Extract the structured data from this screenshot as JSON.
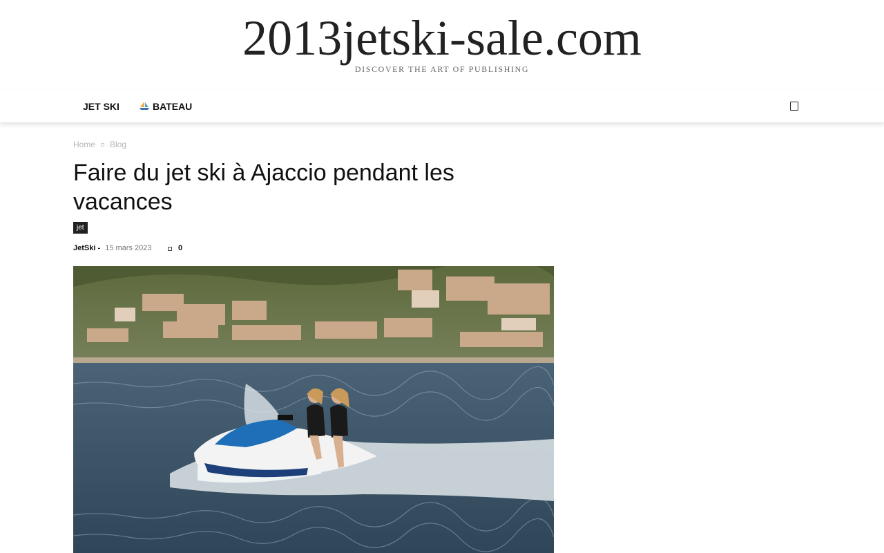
{
  "site": {
    "logo_text": "2013jetski-sale.com",
    "tagline": "DISCOVER THE ART OF PUBLISHING"
  },
  "menu": {
    "items": [
      {
        "label": "JET SKI"
      },
      {
        "label": "BATEAU",
        "icon": "sailboat-icon"
      }
    ],
    "search_icon": "search-icon"
  },
  "breadcrumb": {
    "items": [
      "Home",
      "Blog"
    ]
  },
  "post": {
    "title": "Faire du jet ski à Ajaccio pendant les vacances",
    "category": "jet",
    "author": "JetSki",
    "author_separator": "-",
    "date": "15 mars 2023",
    "comment_count": "0",
    "comment_icon": "comment-icon"
  },
  "colors": {
    "text": "#111111",
    "tag_bg": "#222222",
    "sea": "#3e5a6e",
    "jetski_blue": "#1f6fb8"
  }
}
